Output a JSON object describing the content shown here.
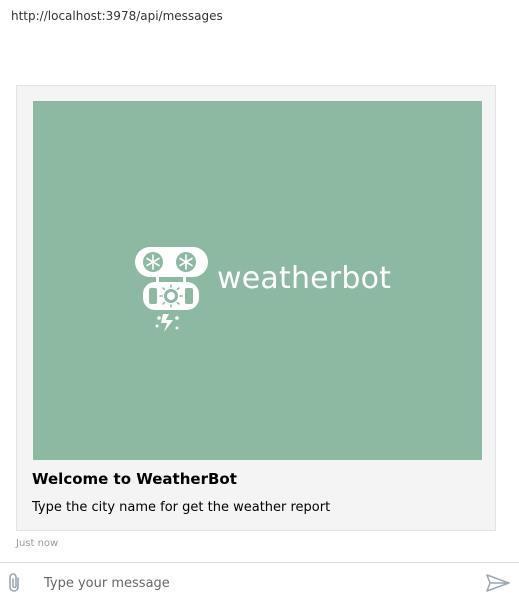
{
  "address_bar": {
    "url": "http://localhost:3978/api/messages"
  },
  "card": {
    "image": {
      "wordmark": "weatherbot",
      "background_color": "#8db8a1",
      "logo_icon": "weatherbot-robot-logo"
    },
    "title": "Welcome to WeatherBot",
    "text": "Type the city name for get the weather report"
  },
  "message_meta": {
    "timestamp": "Just now"
  },
  "composer": {
    "placeholder": "Type your message",
    "value": "",
    "attach_icon": "paperclip-icon",
    "send_icon": "send-icon"
  },
  "colors": {
    "border": "#e2e2e2",
    "card_bg": "#f4f4f4",
    "icon": "#9aa7b3"
  }
}
